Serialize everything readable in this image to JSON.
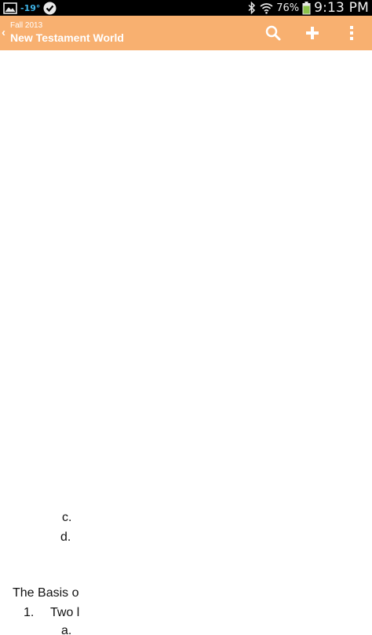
{
  "status_bar": {
    "temperature": "-19°",
    "battery": "76%",
    "time": "9:13 PM",
    "icons": [
      "gallery-icon",
      "check-badge-icon",
      "bluetooth-icon",
      "wifi-icon",
      "battery-icon"
    ]
  },
  "action_bar": {
    "subtitle": "Fall 2013",
    "title": "New Testament World",
    "actions": [
      "search-icon",
      "add-icon",
      "overflow-menu-icon"
    ],
    "color": "#f8b070"
  },
  "document": {
    "list_c": "c.",
    "list_d": "d.",
    "heading": "The Basis o",
    "item_1_number": "1.",
    "item_1_text": "Two l",
    "item_a": "a."
  }
}
